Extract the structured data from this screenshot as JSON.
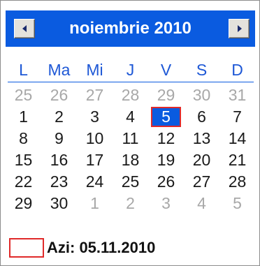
{
  "header": {
    "month_title": "noiembrie 2010",
    "prev_icon": "chevron-left-icon",
    "next_icon": "chevron-right-icon"
  },
  "weekdays": [
    "L",
    "Ma",
    "Mi",
    "J",
    "V",
    "S",
    "D"
  ],
  "weeks": [
    [
      {
        "d": "25",
        "other": true
      },
      {
        "d": "26",
        "other": true
      },
      {
        "d": "27",
        "other": true
      },
      {
        "d": "28",
        "other": true
      },
      {
        "d": "29",
        "other": true
      },
      {
        "d": "30",
        "other": true
      },
      {
        "d": "31",
        "other": true
      }
    ],
    [
      {
        "d": "1"
      },
      {
        "d": "2"
      },
      {
        "d": "3"
      },
      {
        "d": "4"
      },
      {
        "d": "5",
        "selected": true
      },
      {
        "d": "6"
      },
      {
        "d": "7"
      }
    ],
    [
      {
        "d": "8"
      },
      {
        "d": "9"
      },
      {
        "d": "10"
      },
      {
        "d": "11"
      },
      {
        "d": "12"
      },
      {
        "d": "13"
      },
      {
        "d": "14"
      }
    ],
    [
      {
        "d": "15"
      },
      {
        "d": "16"
      },
      {
        "d": "17"
      },
      {
        "d": "18"
      },
      {
        "d": "19"
      },
      {
        "d": "20"
      },
      {
        "d": "21"
      }
    ],
    [
      {
        "d": "22"
      },
      {
        "d": "23"
      },
      {
        "d": "24"
      },
      {
        "d": "25"
      },
      {
        "d": "26"
      },
      {
        "d": "27"
      },
      {
        "d": "28"
      }
    ],
    [
      {
        "d": "29"
      },
      {
        "d": "30"
      },
      {
        "d": "1",
        "other": true
      },
      {
        "d": "2",
        "other": true
      },
      {
        "d": "3",
        "other": true
      },
      {
        "d": "4",
        "other": true
      },
      {
        "d": "5",
        "other": true
      }
    ]
  ],
  "today": {
    "label": "Azi: 05.11.2010"
  },
  "colors": {
    "header_bg": "#0a5be0",
    "weekday_text": "#1e58d6",
    "selected_border": "#e02a2a",
    "other_month_text": "#a8a8a8"
  }
}
